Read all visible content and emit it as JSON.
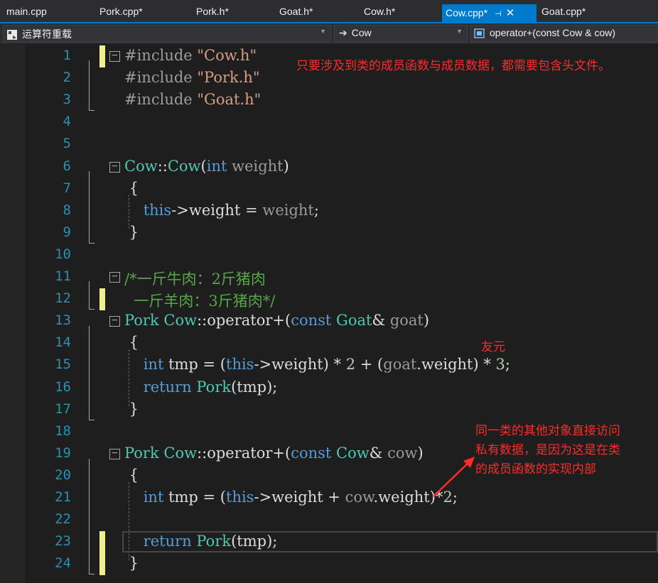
{
  "tabs": [
    {
      "label": "main.cpp",
      "active": false
    },
    {
      "label": "Pork.cpp*",
      "active": false
    },
    {
      "label": "Pork.h*",
      "active": false
    },
    {
      "label": "Goat.h*",
      "active": false
    },
    {
      "label": "Cow.h*",
      "active": false
    },
    {
      "label": "Cow.cpp*",
      "active": true
    },
    {
      "label": "Goat.cpp*",
      "active": false
    }
  ],
  "tab_pin_glyph": "⊣",
  "tab_close_glyph": "✕",
  "nav": {
    "project": "运算符重载",
    "scope": "Cow",
    "member": "operator+(const Cow & cow)"
  },
  "code_lines": [
    {
      "n": "1",
      "tokens": [
        [
          "pp",
          "#include "
        ],
        [
          "str",
          "\"Cow.h\""
        ]
      ]
    },
    {
      "n": "2",
      "tokens": [
        [
          "pp",
          "#include "
        ],
        [
          "str",
          "\"Pork.h\""
        ]
      ]
    },
    {
      "n": "3",
      "tokens": [
        [
          "pp",
          "#include "
        ],
        [
          "str",
          "\"Goat.h\""
        ]
      ]
    },
    {
      "n": "4",
      "tokens": []
    },
    {
      "n": "5",
      "tokens": []
    },
    {
      "n": "6",
      "tokens": [
        [
          "ty",
          "Cow"
        ],
        [
          "fn",
          "::"
        ],
        [
          "ty",
          "Cow"
        ],
        [
          "fn",
          "("
        ],
        [
          "kw",
          "int"
        ],
        [
          "pr",
          " weight"
        ],
        [
          "fn",
          ")"
        ]
      ]
    },
    {
      "n": "7",
      "tokens": [
        [
          "fn",
          " {"
        ]
      ]
    },
    {
      "n": "8",
      "tokens": [
        [
          "fn",
          "    "
        ],
        [
          "kw",
          "this"
        ],
        [
          "fn",
          "->weight = "
        ],
        [
          "pr",
          "weight"
        ],
        [
          "fn",
          ";"
        ]
      ]
    },
    {
      "n": "9",
      "tokens": [
        [
          "fn",
          " }"
        ]
      ]
    },
    {
      "n": "10",
      "tokens": []
    },
    {
      "n": "11",
      "tokens": [
        [
          "cm",
          "/*一斤牛肉：2斤猪肉"
        ]
      ]
    },
    {
      "n": "12",
      "tokens": [
        [
          "cm",
          "  一斤羊肉：3斤猪肉*/"
        ]
      ]
    },
    {
      "n": "13",
      "tokens": [
        [
          "ty",
          "Pork"
        ],
        [
          "fn",
          " "
        ],
        [
          "ty",
          "Cow"
        ],
        [
          "fn",
          "::operator+("
        ],
        [
          "kw",
          "const"
        ],
        [
          "fn",
          " "
        ],
        [
          "ty",
          "Goat"
        ],
        [
          "fn",
          "& "
        ],
        [
          "pr",
          "goat"
        ],
        [
          "fn",
          ")"
        ]
      ]
    },
    {
      "n": "14",
      "tokens": [
        [
          "fn",
          " {"
        ]
      ]
    },
    {
      "n": "15",
      "tokens": [
        [
          "fn",
          "    "
        ],
        [
          "kw",
          "int"
        ],
        [
          "fn",
          " tmp = ("
        ],
        [
          "kw",
          "this"
        ],
        [
          "fn",
          "->weight) * "
        ],
        [
          "num",
          "2"
        ],
        [
          "fn",
          " + ("
        ],
        [
          "pr",
          "goat"
        ],
        [
          "fn",
          ".weight) * "
        ],
        [
          "num",
          "3"
        ],
        [
          "fn",
          ";"
        ]
      ]
    },
    {
      "n": "16",
      "tokens": [
        [
          "fn",
          "    "
        ],
        [
          "kw",
          "return"
        ],
        [
          "fn",
          " "
        ],
        [
          "ty",
          "Pork"
        ],
        [
          "fn",
          "(tmp);"
        ]
      ]
    },
    {
      "n": "17",
      "tokens": [
        [
          "fn",
          " }"
        ]
      ]
    },
    {
      "n": "18",
      "tokens": []
    },
    {
      "n": "19",
      "tokens": [
        [
          "ty",
          "Pork"
        ],
        [
          "fn",
          " "
        ],
        [
          "ty",
          "Cow"
        ],
        [
          "fn",
          "::operator+("
        ],
        [
          "kw",
          "const"
        ],
        [
          "fn",
          " "
        ],
        [
          "ty",
          "Cow"
        ],
        [
          "fn",
          "& "
        ],
        [
          "pr",
          "cow"
        ],
        [
          "fn",
          ")"
        ]
      ]
    },
    {
      "n": "20",
      "tokens": [
        [
          "fn",
          " {"
        ]
      ]
    },
    {
      "n": "21",
      "tokens": [
        [
          "fn",
          "    "
        ],
        [
          "kw",
          "int"
        ],
        [
          "fn",
          " tmp = ("
        ],
        [
          "kw",
          "this"
        ],
        [
          "fn",
          "->weight + "
        ],
        [
          "pr",
          "cow"
        ],
        [
          "fn",
          ".weight)*"
        ],
        [
          "num",
          "2"
        ],
        [
          "fn",
          ";"
        ]
      ]
    },
    {
      "n": "22",
      "tokens": []
    },
    {
      "n": "23",
      "tokens": [
        [
          "fn",
          "    "
        ],
        [
          "kw",
          "return"
        ],
        [
          "fn",
          " "
        ],
        [
          "ty",
          "Pork"
        ],
        [
          "fn",
          "(tmp);"
        ]
      ]
    },
    {
      "n": "24",
      "tokens": [
        [
          "fn",
          " }"
        ]
      ]
    }
  ],
  "annotations": {
    "include_note": "只要涉及到类的成员函数与成员数据，都需要包含头文件。",
    "friend_note": "友元",
    "access_note_line1": "同一类的其他对象直接访问",
    "access_note_line2": "私有数据，是因为这是在类",
    "access_note_line3": "的成员函数的实现内部"
  },
  "colors": {
    "accent": "#007acc",
    "keyword": "#569cd6",
    "type": "#4ec9b0",
    "comment": "#57a64a",
    "string": "#d69d85",
    "annotation": "#ff2a2a",
    "change_marker": "#efef91"
  }
}
